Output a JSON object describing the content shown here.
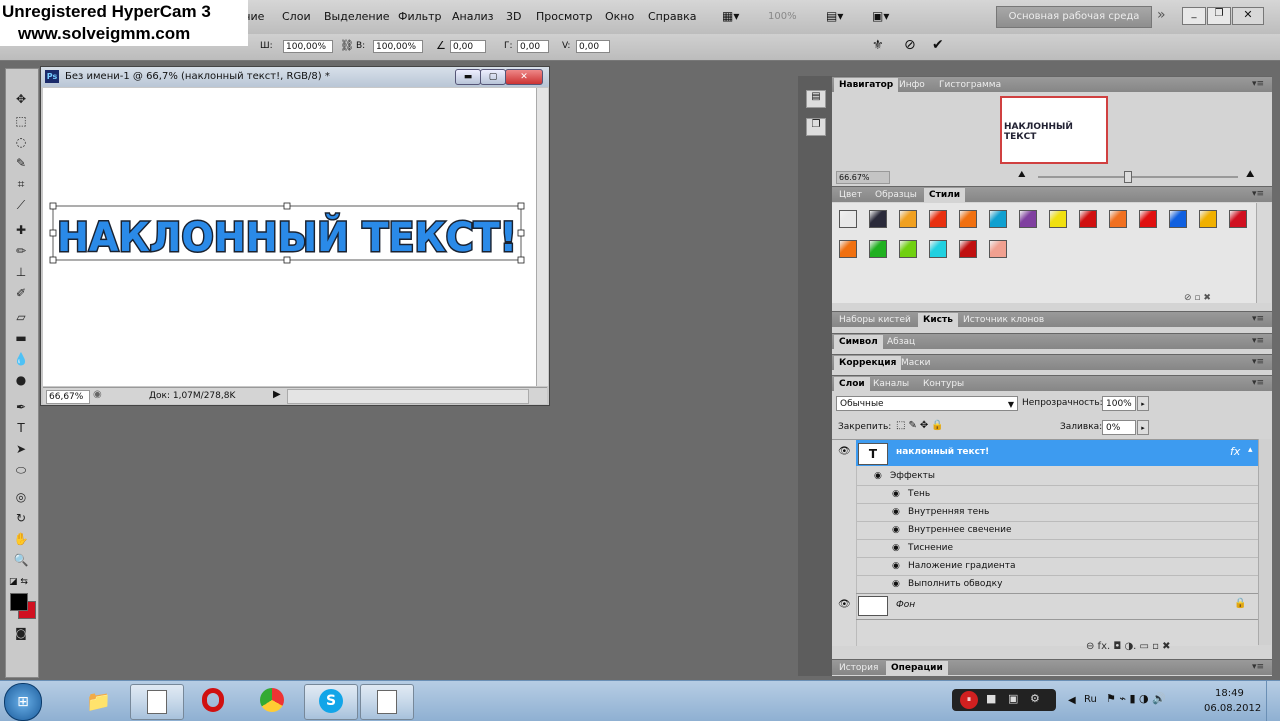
{
  "watermark": {
    "line1": "Unregistered HyperCam 3",
    "line2": "www.solveigmm.com"
  },
  "menubar": {
    "items": [
      "чие",
      "Слои",
      "Выделение",
      "Фильтр",
      "Анализ",
      "3D",
      "Просмотр",
      "Окно",
      "Справка"
    ],
    "zoom": "100%",
    "workspace": "Основная рабочая среда"
  },
  "options": {
    "w_label": "Ш:",
    "w_value": "100,00%",
    "h_label": "В:",
    "h_value": "100,00%",
    "angle_value": "0,00",
    "hskew_label": "Г:",
    "hskew_value": "0,00",
    "vskew_label": "V:",
    "vskew_value": "0,00"
  },
  "document": {
    "title": "Без имени-1 @ 66,7% (наклонный текст!, RGB/8) *",
    "app_badge": "Ps",
    "canvas_text": "НАКЛОННЫЙ ТЕКСТ!",
    "zoom": "66,67%",
    "doc_info": "Док: 1,07M/278,8K"
  },
  "navigator": {
    "tabs": [
      "Навигатор",
      "Инфо",
      "Гистограмма"
    ],
    "zoom": "66.67%",
    "thumb_text": "НАКЛОННЫЙ ТЕКСТ"
  },
  "styles_panel": {
    "tabs": [
      "Цвет",
      "Образцы",
      "Стили"
    ],
    "swatches": [
      "#e8e8e8",
      "#2a2a3a",
      "#f0a020",
      "#e83010",
      "#f07010",
      "#10a0d0",
      "#8040a0",
      "#f0e010",
      "#d01010",
      "#f07020",
      "#e01010",
      "#1060e0",
      "#f0b000",
      "#d01020",
      "#f07010",
      "#20b020",
      "#70d010",
      "#20d0e0",
      "#c01010",
      "#f0a090"
    ]
  },
  "brush_tabs": [
    "Наборы кистей",
    "Кисть",
    "Источник клонов"
  ],
  "char_tabs": [
    "Символ",
    "Абзац"
  ],
  "adj_tabs": [
    "Коррекция",
    "Маски"
  ],
  "layers": {
    "tabs": [
      "Слои",
      "Каналы",
      "Контуры"
    ],
    "blend_mode": "Обычные",
    "opacity_label": "Непрозрачность:",
    "opacity": "100%",
    "lock_label": "Закрепить:",
    "fill_label": "Заливка:",
    "fill": "0%",
    "text_layer": {
      "thumb": "T",
      "name": "наклонный текст!",
      "fx": "fx"
    },
    "effects_label": "Эффекты",
    "effects": [
      "Тень",
      "Внутренняя тень",
      "Внутреннее свечение",
      "Тиснение",
      "Наложение градиента",
      "Выполнить обводку"
    ],
    "bg_layer": "Фон",
    "bottom_icons": "⊖  fx.  ◘  ◑.  ▭  ▫  ✖"
  },
  "bottom_tabs": [
    "История",
    "Операции"
  ],
  "taskbar": {
    "lang": "Ru",
    "time": "18:49",
    "date": "06.08.2012"
  },
  "colors": {
    "accent": "#3d9bf0",
    "layer_selected": "#3d9bf0",
    "canvas_text_fill": "#2a8ae8",
    "canvas_text_stroke": "#1a2230"
  }
}
